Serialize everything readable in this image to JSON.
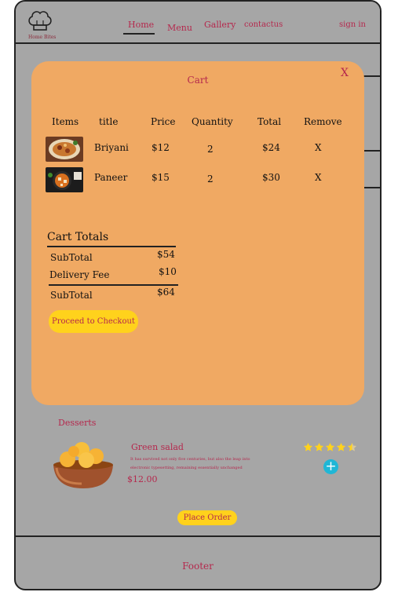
{
  "brand": {
    "name": "Home Bites"
  },
  "nav": {
    "links": [
      "Home",
      "Menu",
      "Gallery",
      "contactus"
    ],
    "sign_in": "sign in"
  },
  "cart": {
    "title": "Cart",
    "close": "X",
    "headers": [
      "Items",
      "title",
      "Price",
      "Quantity",
      "Total",
      "Remove"
    ],
    "items": [
      {
        "title": "Briyani",
        "price": "$12",
        "quantity": "2",
        "total": "$24",
        "remove": "X"
      },
      {
        "title": "Paneer",
        "price": "$15",
        "quantity": "2",
        "total": "$30",
        "remove": "X"
      }
    ],
    "totals": {
      "heading": "Cart Totals",
      "subtotal_label": "SubTotal",
      "subtotal_value": "$54",
      "delivery_label": "Delivery Fee",
      "delivery_value": "$10",
      "total_label": "SubTotal",
      "total_value": "$64"
    },
    "checkout_label": "Proceed to Checkout"
  },
  "menu_section": {
    "title": "Desserts",
    "dish": {
      "name": "Green salad",
      "description": "It has survived not only five centuries, but also the leap into electronic typesetting, remaining essentially unchanged",
      "price": "$12.00",
      "rating": 4.5
    },
    "add_label": "+"
  },
  "place_order_label": "Place Order",
  "footer": {
    "text": "Footer"
  },
  "colors": {
    "accent": "#b5284d",
    "modal": "#f0a963",
    "button": "#ffd21c",
    "background": "#a6a6a6",
    "add_button": "#20b7d6",
    "star": "#ffd21c"
  }
}
